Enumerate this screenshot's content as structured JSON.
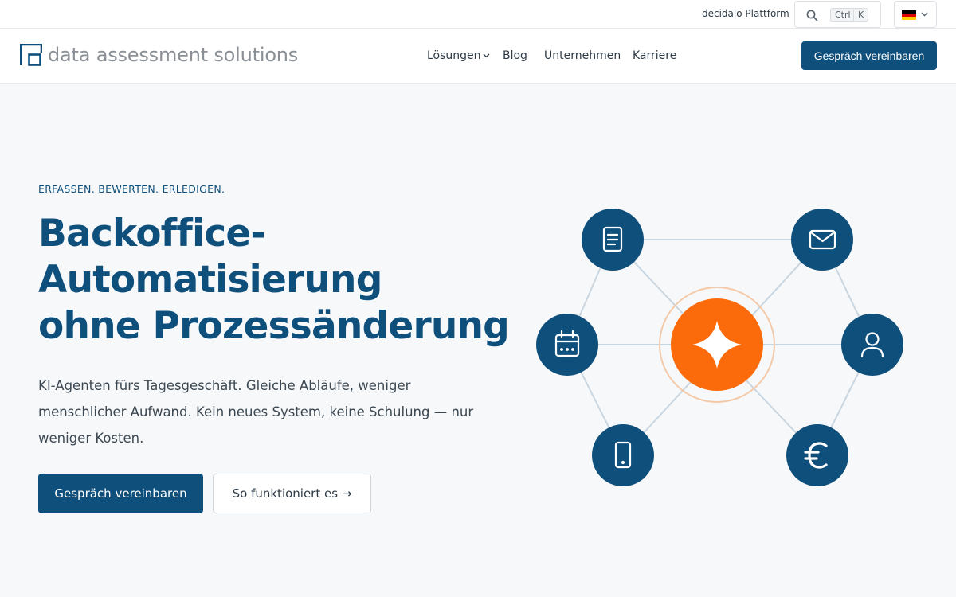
{
  "utility": {
    "platform_link": "decidalo Plattform",
    "search_kbd_ctrl": "Ctrl",
    "search_kbd_k": "K",
    "language_flag": "de-flag-icon"
  },
  "nav": {
    "logo_text": "data assessment solutions",
    "items": [
      {
        "label": "Lösungen"
      },
      {
        "label": "Blog"
      },
      {
        "label": "Unternehmen"
      },
      {
        "label": "Karriere"
      }
    ],
    "cta": "Gespräch vereinbaren"
  },
  "hero": {
    "eyebrow": "ERFASSEN. BEWERTEN. ERLEDIGEN.",
    "headline": [
      "Backoffice-",
      "Automatisierung",
      "ohne Prozessänderung"
    ],
    "lede": "KI-Agenten fürs Tagesgeschäft. Gleiche Abläufe, weniger menschlicher Aufwand. Kein neues System, keine Schulung — nur weniger Kosten.",
    "primary_button": "Gespräch vereinbaren",
    "secondary_button": "So funktioniert es →"
  },
  "diagram": {
    "center_icon": "sparkle-icon",
    "nodes": [
      "document-icon",
      "mail-icon",
      "calendar-icon",
      "user-icon",
      "mobile-icon",
      "euro-icon"
    ],
    "colors": {
      "node": "#0f4f7c",
      "center": "#fb6b0c",
      "line": "#c9d6e0",
      "halo": "#f4c9a8"
    }
  },
  "colors": {
    "brand": "#0f4f7c",
    "accent": "#fb6b0c",
    "background": "#f7f8fa"
  }
}
